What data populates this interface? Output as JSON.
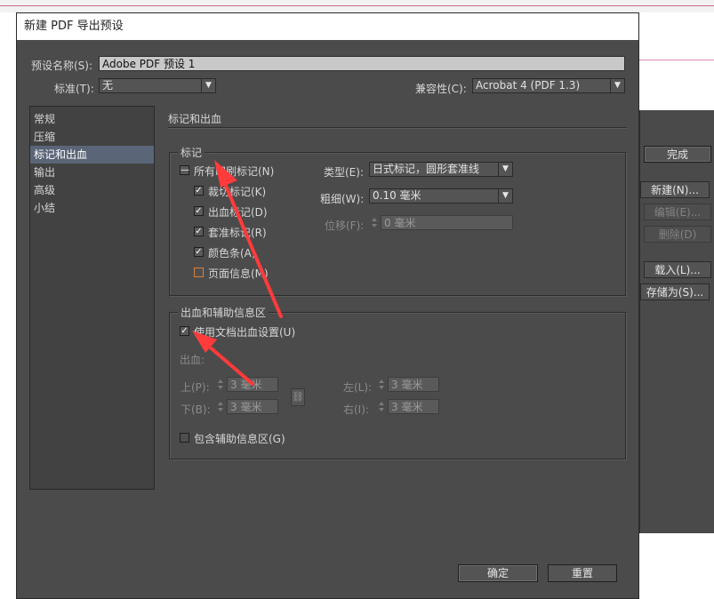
{
  "colors": {
    "accent_arrow": "#ff3b3b",
    "selected_row": "#5a6577",
    "dialog_bg": "#4b4b4b"
  },
  "window_title": "新建 PDF 导出预设",
  "top": {
    "preset_name_label": "预设名称(S):",
    "preset_name_value": "Adobe PDF 预设 1",
    "standard_label": "标准(T):",
    "standard_value": "无",
    "compat_label": "兼容性(C):",
    "compat_value": "Acrobat 4 (PDF 1.3)"
  },
  "sidebar": {
    "items": [
      {
        "label": "常规"
      },
      {
        "label": "压缩"
      },
      {
        "label": "标记和出血",
        "selected": true
      },
      {
        "label": "输出"
      },
      {
        "label": "高级"
      },
      {
        "label": "小结"
      }
    ]
  },
  "section_title": "标记和出血",
  "marks": {
    "group_title": "标记",
    "all_marks_label": "所有印刷标记(N)",
    "items": [
      {
        "label": "裁切标记(K)",
        "checked": true
      },
      {
        "label": "出血标记(D)",
        "checked": true
      },
      {
        "label": "套准标记(R)",
        "checked": true
      },
      {
        "label": "颜色条(A)",
        "checked": true
      },
      {
        "label": "页面信息(M)",
        "checked": false
      }
    ],
    "type_label": "类型(E):",
    "type_value": "日式标记，圆形套准线",
    "weight_label": "粗细(W):",
    "weight_value": "0.10 毫米",
    "offset_label": "位移(F):",
    "offset_value": "0 毫米"
  },
  "bleed": {
    "group_title": "出血和辅助信息区",
    "use_doc_label": "使用文档出血设置(U)",
    "bleed_label": "出血:",
    "top_label": "上(P):",
    "top_value": "3 毫米",
    "bottom_label": "下(B):",
    "bottom_value": "3 毫米",
    "left_label": "左(L):",
    "left_value": "3 毫米",
    "right_label": "右(I):",
    "right_value": "3 毫米",
    "slug_label": "包含辅助信息区(G)"
  },
  "buttons": {
    "ok": "确定",
    "reset": "重置"
  },
  "background_panel": {
    "done": "完成",
    "new": "新建(N)...",
    "edit": "编辑(E)...",
    "delete": "删除(D)",
    "load": "载入(L)...",
    "save_as": "存储为(S)..."
  }
}
